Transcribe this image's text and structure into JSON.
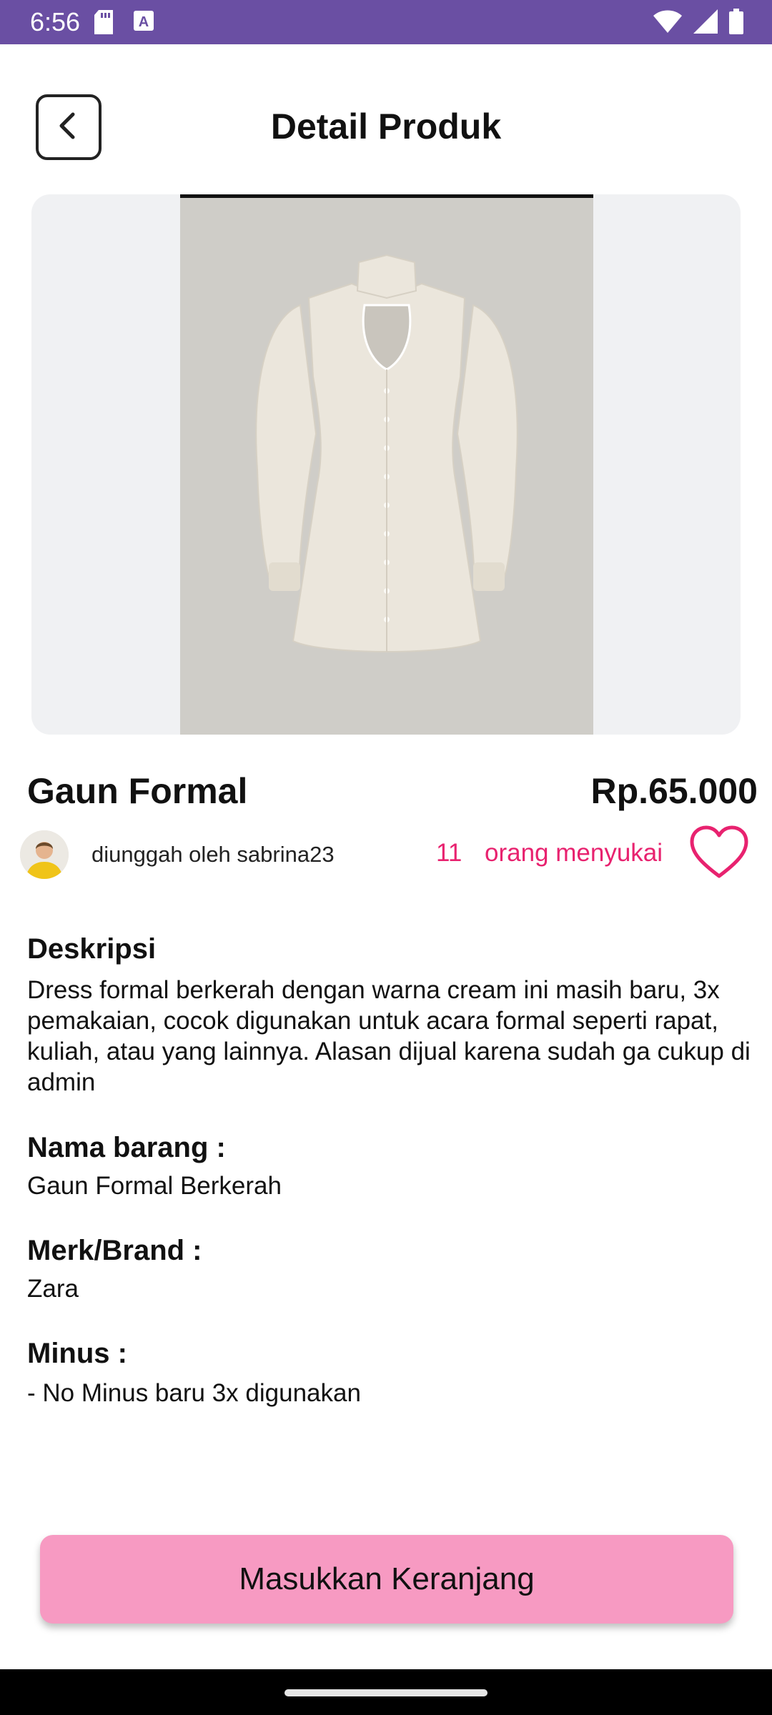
{
  "status_bar": {
    "time": "6:56",
    "icons": [
      "sd-card-icon",
      "text-a-icon",
      "wifi-icon",
      "signal-icon",
      "battery-icon"
    ]
  },
  "header": {
    "title": "Detail Produk",
    "back_icon": "chevron-left-icon"
  },
  "product": {
    "name": "Gaun Formal",
    "price": "Rp.65.000",
    "uploader": "diunggah oleh sabrina23",
    "like_count": "11",
    "like_label": "orang menyukai",
    "like_icon": "heart-outline-icon",
    "accent_color": "#e8226f"
  },
  "sections": {
    "description": {
      "title": "Deskripsi",
      "body": "Dress formal berkerah dengan warna cream ini masih baru, 3x pemakaian, cocok digunakan untuk acara formal seperti rapat, kuliah, atau yang lainnya. Alasan dijual karena sudah ga cukup di admin"
    },
    "item_name": {
      "title": "Nama barang :",
      "body": "Gaun Formal Berkerah"
    },
    "brand": {
      "title": "Merk/Brand :",
      "body": "Zara"
    },
    "minus": {
      "title": "Minus :",
      "body": "- No Minus baru 3x digunakan"
    }
  },
  "cta": {
    "label": "Masukkan Keranjang",
    "color": "#f79ac2"
  },
  "colors": {
    "status_bar": "#6a4fa3"
  }
}
